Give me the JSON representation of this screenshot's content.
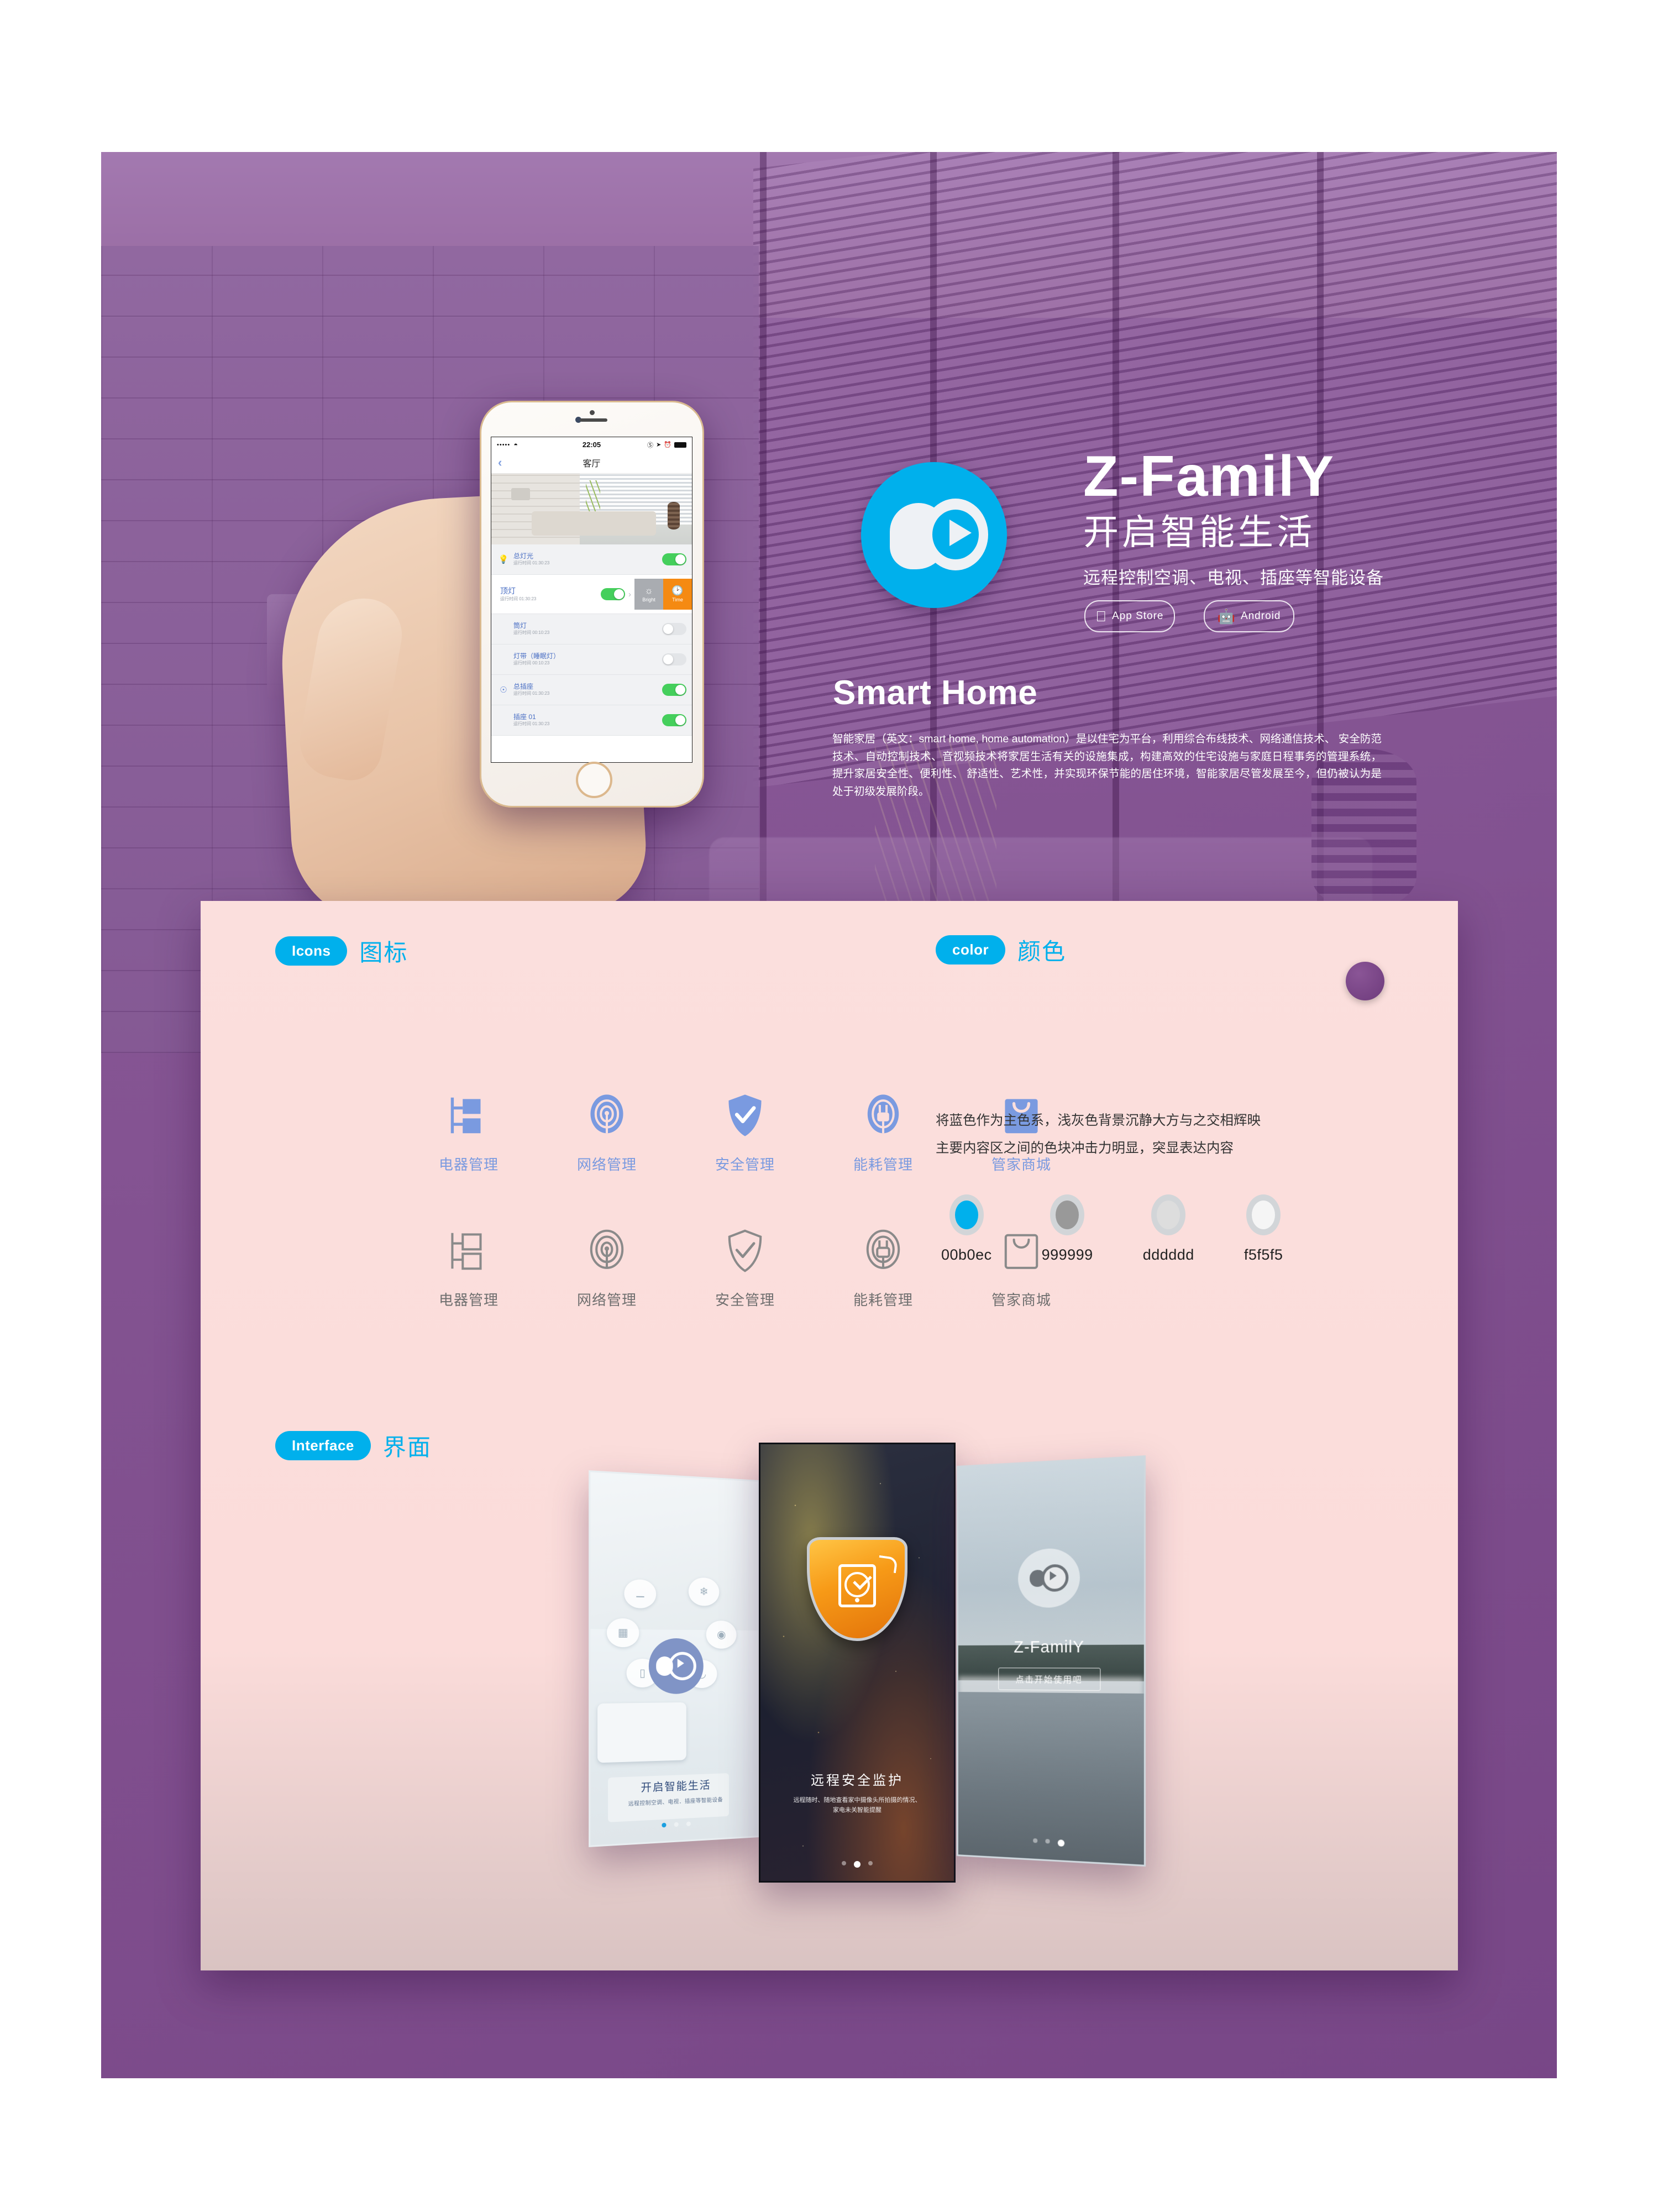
{
  "brand": {
    "name": "Z-FamilY",
    "tagline_cn": "开启智能生活",
    "subtitle_cn": "远程控制空调、电视、插座等智能设备",
    "section_title_en": "Smart Home",
    "description": "智能家居（英文：smart home, home automation）是以住宅为平台，利用综合布线技术、网络通信技术、 安全防范技术、自动控制技术、音视频技术将家居生活有关的设施集成，构建高效的住宅设施与家庭日程事务的管理系统，提升家居安全性、便利性、 舒适性、艺术性，并实现环保节能的居住环境，智能家居尽管发展至今，但仍被认为是处于初级发展阶段。",
    "accent_color": "#00b0ec"
  },
  "stores": [
    {
      "label": "App Store",
      "icon": "apple-icon"
    },
    {
      "label": "Android",
      "icon": "android-icon"
    }
  ],
  "phone": {
    "status_bar": {
      "signal": "•••••",
      "wifi": "wifi-icon",
      "time": "22:05",
      "lock": "rotation-lock-icon",
      "location": "location-icon",
      "alarm": "alarm-icon",
      "battery": "battery-icon"
    },
    "nav": {
      "back": "‹",
      "title": "客厅"
    },
    "runtime_label": "运行时间",
    "devices": [
      {
        "icon": "bulb-icon",
        "name": "总灯光",
        "runtime": "01:30:23",
        "toggle": "on",
        "expanded": false
      },
      {
        "icon": "",
        "name": "顶灯",
        "runtime": "01:30:23",
        "toggle": "on",
        "expanded": true,
        "actions": [
          {
            "label": "Bright",
            "icon": "brightness-icon"
          },
          {
            "label": "Time",
            "icon": "clock-icon"
          }
        ]
      },
      {
        "icon": "",
        "name": "筒灯",
        "runtime": "00:10:23",
        "toggle": "off",
        "expanded": false
      },
      {
        "icon": "",
        "name": "灯带（睡眠灯）",
        "runtime": "00:10:23",
        "toggle": "off",
        "expanded": false
      },
      {
        "icon": "socket-icon",
        "name": "总插座",
        "runtime": "01:30:23",
        "toggle": "on",
        "expanded": false
      },
      {
        "icon": "",
        "name": "插座 01",
        "runtime": "01:30:23",
        "toggle": "on",
        "expanded": false
      }
    ]
  },
  "sections": {
    "icons": {
      "badge": "Icons",
      "cn": "图标"
    },
    "color": {
      "badge": "color",
      "cn": "颜色"
    },
    "interface": {
      "badge": "Interface",
      "cn": "界面"
    }
  },
  "icon_set": {
    "row_filled": [
      {
        "name": "appliance-management-icon",
        "label": "电器管理"
      },
      {
        "name": "network-management-icon",
        "label": "网络管理"
      },
      {
        "name": "security-management-icon",
        "label": "安全管理"
      },
      {
        "name": "energy-management-icon",
        "label": "能耗管理"
      },
      {
        "name": "butler-mall-icon",
        "label": "管家商城"
      }
    ],
    "row_outline": [
      {
        "name": "appliance-management-icon",
        "label": "电器管理"
      },
      {
        "name": "network-management-icon",
        "label": "网络管理"
      },
      {
        "name": "security-management-icon",
        "label": "安全管理"
      },
      {
        "name": "energy-management-icon",
        "label": "能耗管理"
      },
      {
        "name": "butler-mall-icon",
        "label": "管家商城"
      }
    ],
    "filled_color": "#7a9ae0",
    "outline_color": "#6f6f6f"
  },
  "color_section": {
    "desc_line1": "将蓝色作为主色系，浅灰色背景沉静大方与之交相辉映",
    "desc_line2": "主要内容区之间的色块冲击力明显，突显表达内容",
    "swatches": [
      {
        "label": "00b0ec",
        "hex": "#00b0ec"
      },
      {
        "label": "999999",
        "hex": "#999999"
      },
      {
        "label": "dddddd",
        "hex": "#dddddd"
      },
      {
        "label": "f5f5f5",
        "hex": "#f5f5f5"
      }
    ]
  },
  "mockups": [
    {
      "id": "onboarding-1",
      "title": "开启智能生活",
      "subtitle": "远程控制空调、电视．插座等智能设备",
      "dots": 3,
      "active_dot": 1
    },
    {
      "id": "onboarding-2",
      "title": "远程安全监护",
      "subtitle_line1": "远程随时、随地查看家中摄像头所拍摄的情况、",
      "subtitle_line2": "家电未关智能提醒",
      "dots": 3,
      "active_dot": 2
    },
    {
      "id": "onboarding-3",
      "title": "Z-FamilY",
      "button": "点击开始使用吧",
      "dots": 3,
      "active_dot": 3
    }
  ],
  "theme": {
    "purple_bg": "#835390",
    "pink_panel": "#fbdfdd",
    "accent_blue": "#00b0ec"
  }
}
